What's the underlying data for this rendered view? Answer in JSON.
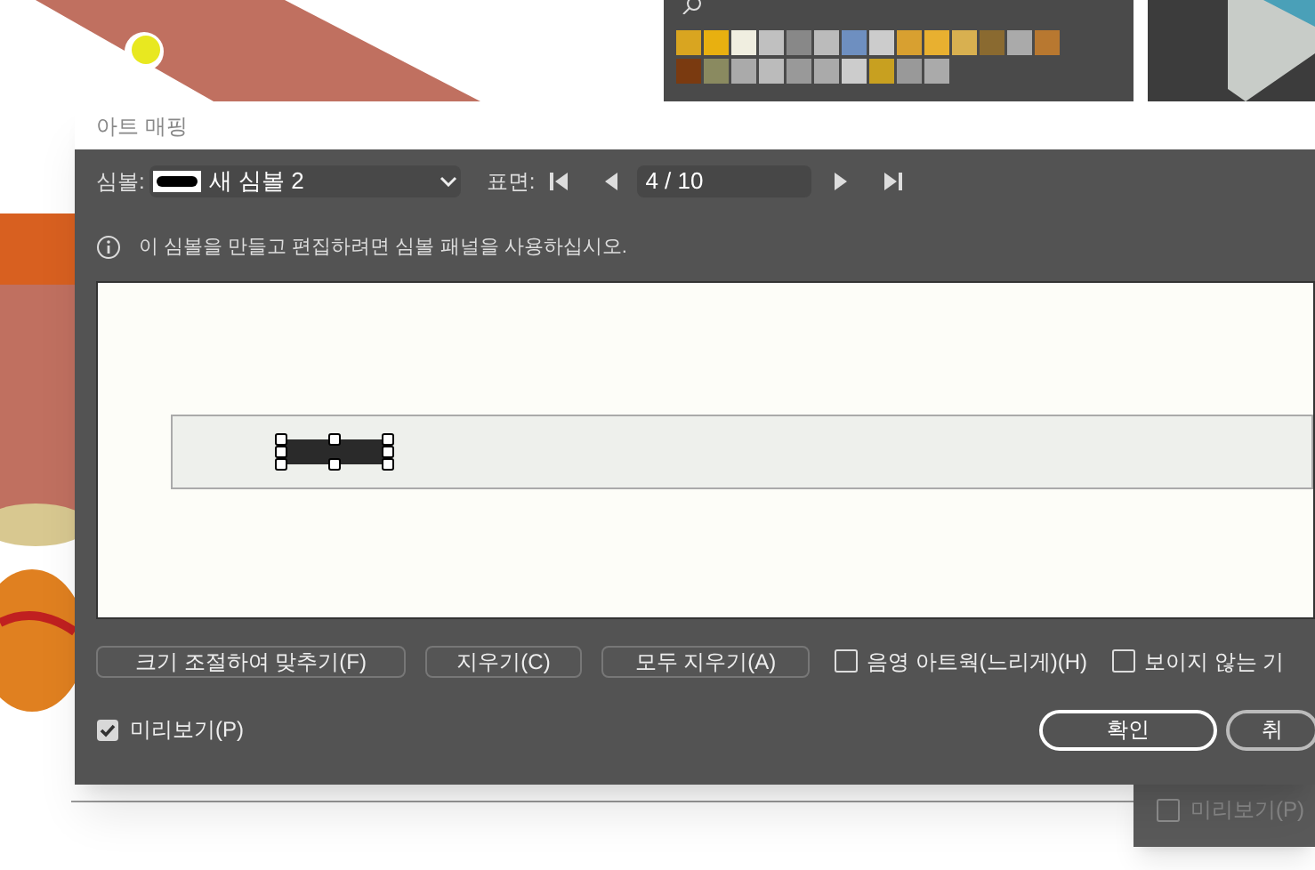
{
  "dialog": {
    "title": "아트 매핑",
    "symbol": {
      "label": "심볼:",
      "value": "새 심볼 2"
    },
    "surface": {
      "label": "표면:",
      "value": "4 / 10"
    },
    "info": "이 심볼을 만들고 편집하려면 심볼 패널을 사용하십시오.",
    "buttons": [
      "크기 조절하여 맞추기(F)",
      "지우기(C)",
      "모두 지우기(A)"
    ],
    "options": [
      {
        "label": "음영 아트웍(느리게)(H)",
        "checked": false
      },
      {
        "label": "보이지 않는 기",
        "checked": false
      }
    ],
    "preview": {
      "label": "미리보기(P)",
      "checked": true
    },
    "actions": [
      {
        "label": "확인",
        "selected": true
      },
      {
        "label": "취",
        "selected": false
      }
    ]
  },
  "background_panel": {
    "preview": {
      "label": "미리보기(P)",
      "checked": false
    }
  }
}
